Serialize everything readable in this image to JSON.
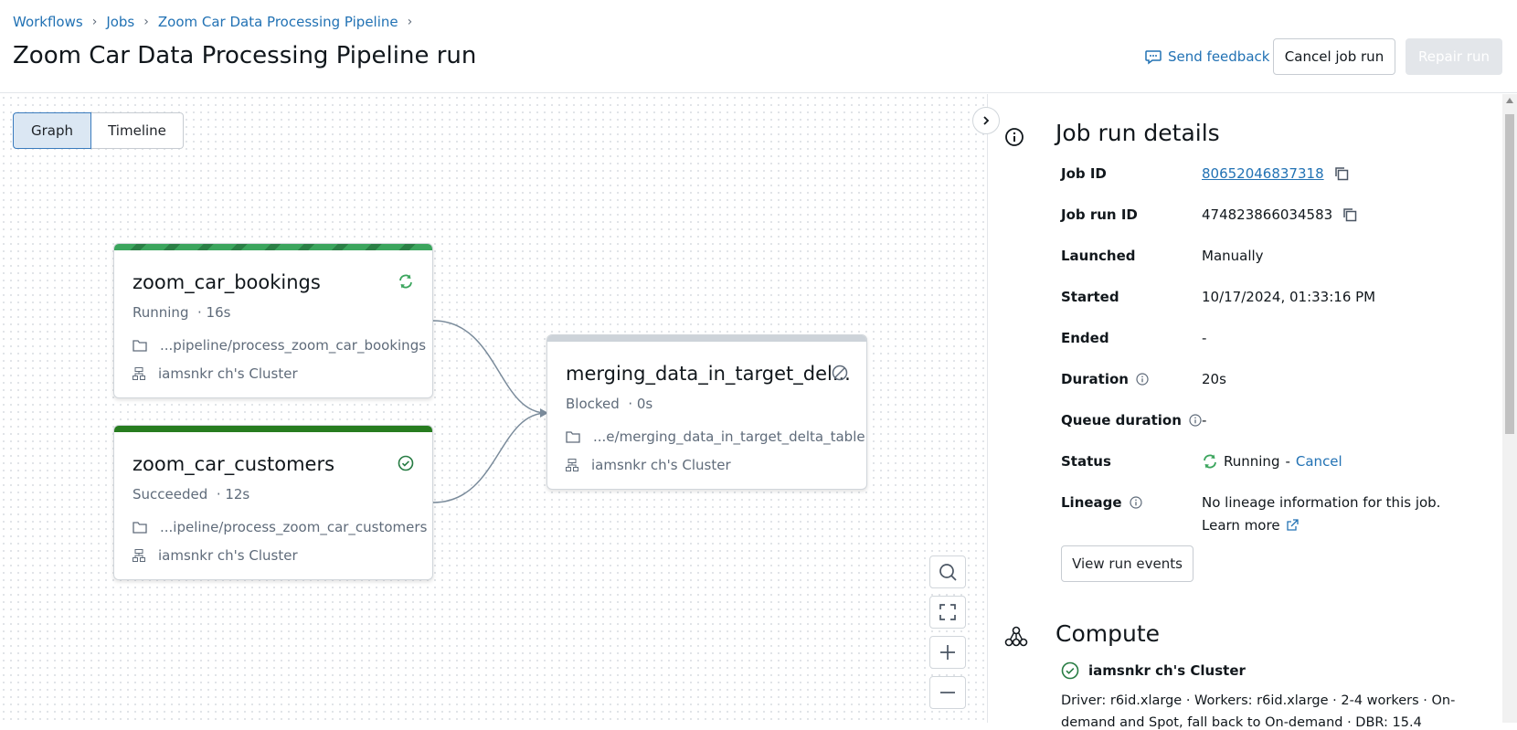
{
  "breadcrumb": [
    "Workflows",
    "Jobs",
    "Zoom Car Data Processing Pipeline"
  ],
  "title": "Zoom Car Data Processing Pipeline run",
  "header": {
    "feedback_label": "Send feedback",
    "cancel_label": "Cancel job run",
    "repair_label": "Repair run"
  },
  "view_tabs": {
    "graph": "Graph",
    "timeline": "Timeline",
    "selected": "Graph"
  },
  "tasks": [
    {
      "name": "zoom_car_bookings",
      "status": "Running",
      "duration": "· 16s",
      "path": "...pipeline/process_zoom_car_bookings",
      "cluster": "iamsnkr ch's Cluster"
    },
    {
      "name": "zoom_car_customers",
      "status": "Succeeded",
      "duration": "· 12s",
      "path": "...ipeline/process_zoom_car_customers",
      "cluster": "iamsnkr ch's Cluster"
    },
    {
      "name": "merging_data_in_target_del...",
      "status": "Blocked",
      "duration": "· 0s",
      "path": "...e/merging_data_in_target_delta_table",
      "cluster": "iamsnkr ch's Cluster"
    }
  ],
  "details": {
    "title": "Job run details",
    "job_id_label": "Job ID",
    "job_id": "80652046837318",
    "run_id_label": "Job run ID",
    "run_id": "474823866034583",
    "launched_label": "Launched",
    "launched": "Manually",
    "started_label": "Started",
    "started": "10/17/2024, 01:33:16 PM",
    "ended_label": "Ended",
    "ended": "-",
    "duration_label": "Duration",
    "duration": "20s",
    "queue_label": "Queue duration",
    "queue": "-",
    "status_label": "Status",
    "status": "Running",
    "status_sep": "-",
    "status_cancel": "Cancel",
    "lineage_label": "Lineage",
    "lineage": "No lineage information for this job.",
    "learn_more": "Learn more",
    "view_events": "View run events"
  },
  "compute": {
    "title": "Compute",
    "cluster": "iamsnkr ch's Cluster",
    "line1": "Driver: r6id.xlarge · Workers: r6id.xlarge · 2-4 workers · On-",
    "line2": "demand and Spot, fall back to On-demand · DBR: 15.4"
  },
  "colors": {
    "accent": "#2272b4",
    "running": "#3ba55d",
    "success": "#277c43",
    "blocked": "#cdd3d9"
  }
}
